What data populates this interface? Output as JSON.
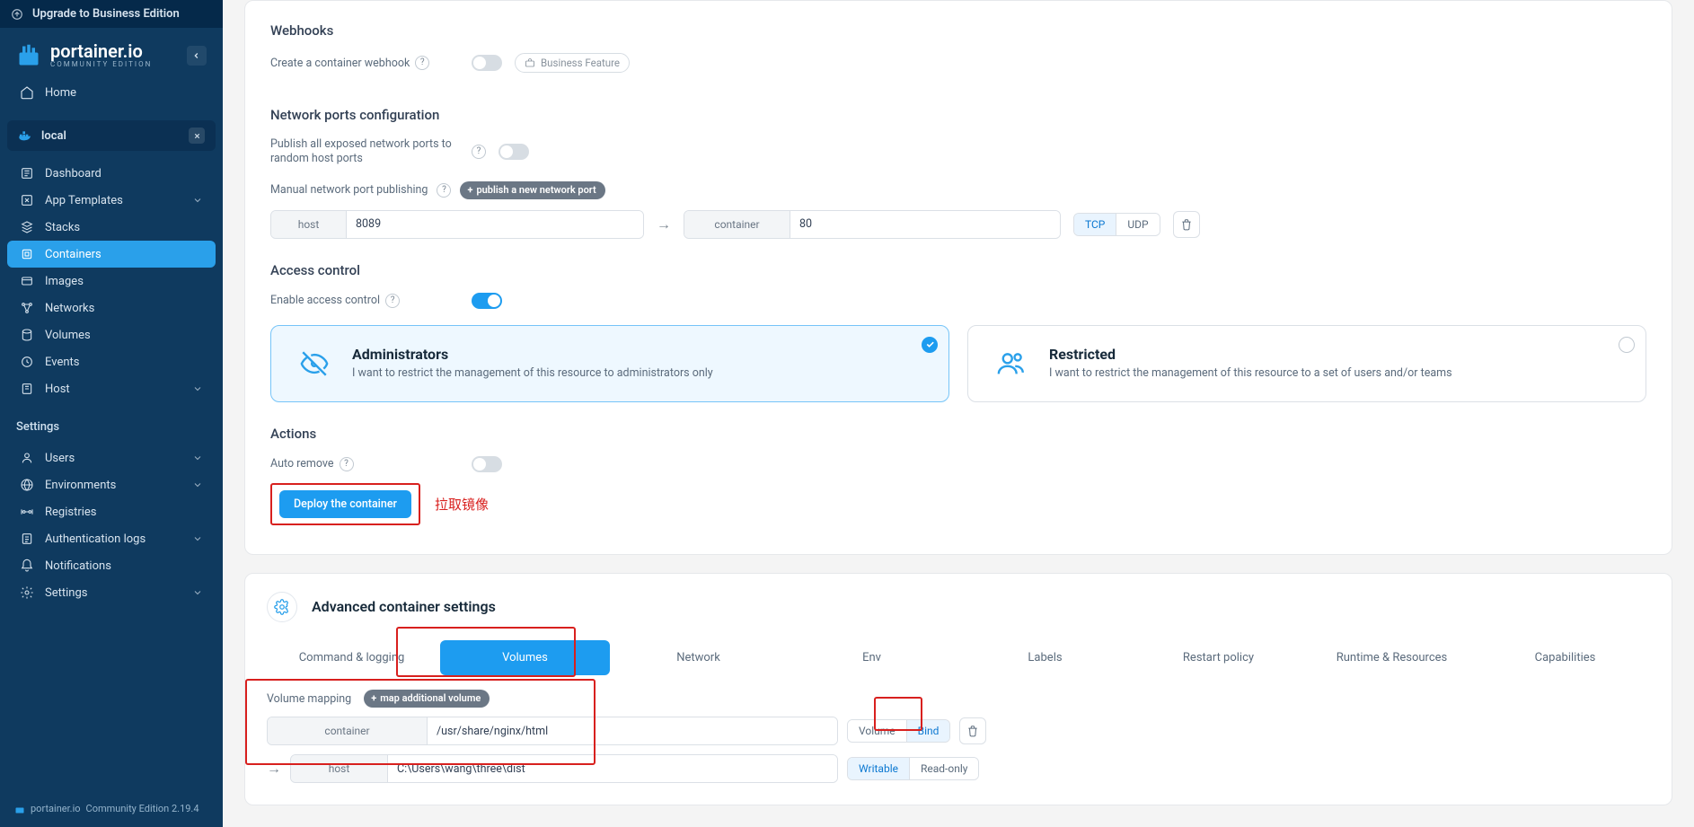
{
  "sidebar": {
    "upgrade": "Upgrade to Business Edition",
    "brand": "portainer.io",
    "brand_sub": "COMMUNITY EDITION",
    "home": "Home",
    "env_name": "local",
    "items": [
      {
        "label": "Dashboard"
      },
      {
        "label": "App Templates",
        "expandable": true
      },
      {
        "label": "Stacks"
      },
      {
        "label": "Containers",
        "active": true
      },
      {
        "label": "Images"
      },
      {
        "label": "Networks"
      },
      {
        "label": "Volumes"
      },
      {
        "label": "Events"
      },
      {
        "label": "Host",
        "expandable": true
      }
    ],
    "settings_heading": "Settings",
    "settings": [
      {
        "label": "Users",
        "expandable": true
      },
      {
        "label": "Environments",
        "expandable": true
      },
      {
        "label": "Registries"
      },
      {
        "label": "Authentication logs",
        "expandable": true
      },
      {
        "label": "Notifications"
      },
      {
        "label": "Settings",
        "expandable": true
      }
    ],
    "footer_brand": "portainer.io",
    "footer_text": "Community Edition 2.19.4"
  },
  "webhooks": {
    "title": "Webhooks",
    "create_label": "Create a container webhook",
    "business": "Business Feature"
  },
  "network": {
    "title": "Network ports configuration",
    "publish_all": "Publish all exposed network ports to random host ports",
    "manual_label": "Manual network port publishing",
    "publish_btn": "publish a new network port",
    "row": {
      "host_label": "host",
      "host_value": "8089",
      "container_label": "container",
      "container_value": "80",
      "proto_tcp": "TCP",
      "proto_udp": "UDP"
    }
  },
  "access": {
    "title": "Access control",
    "enable": "Enable access control",
    "admin": {
      "title": "Administrators",
      "sub": "I want to restrict the management of this resource to administrators only"
    },
    "restricted": {
      "title": "Restricted",
      "sub": "I want to restrict the management of this resource to a set of users and/or teams"
    }
  },
  "actions": {
    "title": "Actions",
    "auto_remove": "Auto remove",
    "deploy": "Deploy the container",
    "annotation": "拉取镜像"
  },
  "advanced": {
    "title": "Advanced container settings",
    "tabs": [
      "Command & logging",
      "Volumes",
      "Network",
      "Env",
      "Labels",
      "Restart policy",
      "Runtime & Resources",
      "Capabilities"
    ],
    "volume": {
      "mapping": "Volume mapping",
      "map_btn": "map additional volume",
      "container_label": "container",
      "container_value": "/usr/share/nginx/html",
      "type_volume": "Volume",
      "type_bind": "Bind",
      "host_label": "host",
      "host_value": "C:\\Users\\wang\\three\\dist",
      "writable": "Writable",
      "readonly": "Read-only"
    }
  }
}
